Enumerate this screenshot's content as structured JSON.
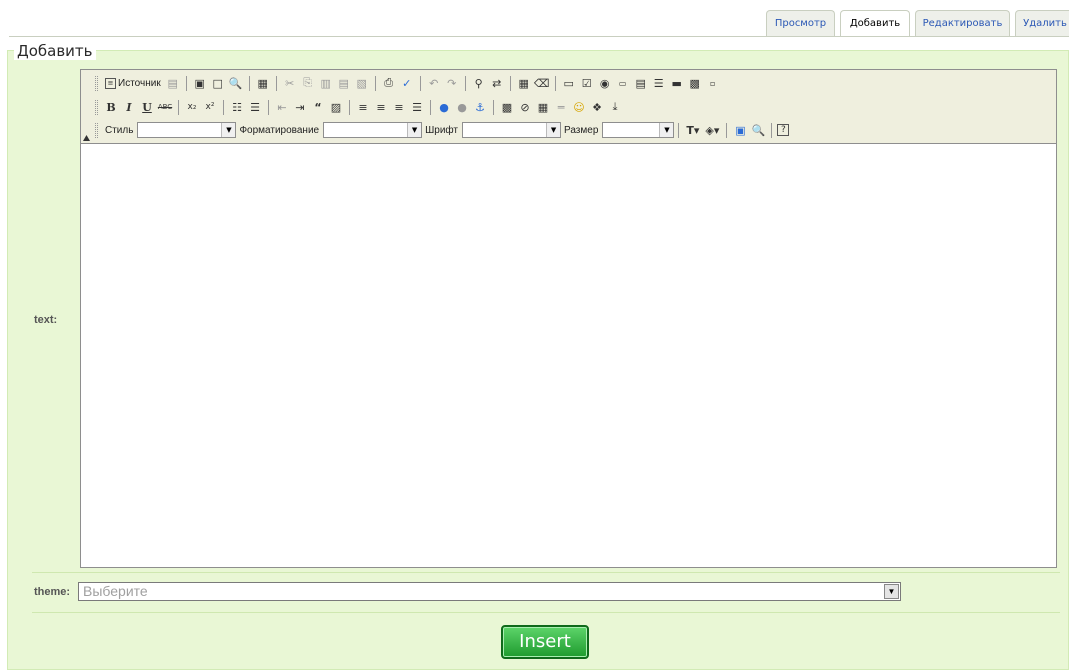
{
  "tabs": [
    {
      "label": "Просмотр",
      "active": false
    },
    {
      "label": "Добавить",
      "active": true
    },
    {
      "label": "Редактировать",
      "active": false
    },
    {
      "label": "Удалить",
      "active": false
    }
  ],
  "form": {
    "legend": "Добавить",
    "text_label": "text:",
    "theme_label": "theme:",
    "theme_value": "Выберите",
    "insert_label": "Insert"
  },
  "toolbar": {
    "source_label": "Источник",
    "style_label": "Стиль",
    "format_label": "Форматирование",
    "font_label": "Шрифт",
    "size_label": "Размер",
    "row1_icons": [
      "templates-icon",
      "save-icon",
      "new-page-icon",
      "preview-icon",
      "paste-template-icon",
      "cut-icon",
      "copy-icon",
      "paste-icon",
      "paste-text-icon",
      "paste-word-icon",
      "print-icon",
      "spellcheck-icon",
      "undo-icon",
      "redo-icon",
      "find-icon",
      "replace-icon",
      "select-all-icon",
      "remove-format-icon",
      "form-icon",
      "checkbox-icon",
      "radio-icon",
      "textfield-icon",
      "textarea-icon",
      "select-field-icon",
      "button-field-icon",
      "image-button-icon",
      "hidden-field-icon"
    ],
    "row2_icons": [
      "bold-icon",
      "italic-icon",
      "underline-icon",
      "strike-icon",
      "subscript-icon",
      "superscript-icon",
      "numbered-list-icon",
      "bulleted-list-icon",
      "outdent-icon",
      "indent-icon",
      "blockquote-icon",
      "div-icon",
      "align-left-icon",
      "align-center-icon",
      "align-right-icon",
      "justify-icon",
      "link-icon",
      "unlink-icon",
      "anchor-icon",
      "image-icon",
      "flash-icon",
      "table-icon",
      "horizontal-rule-icon",
      "smiley-icon",
      "special-char-icon",
      "page-break-icon"
    ],
    "row3_icons": [
      "text-color-icon",
      "background-color-icon",
      "maximize-icon",
      "show-blocks-icon",
      "about-icon"
    ]
  },
  "colors": {
    "panel_bg": "#e9f7d5",
    "toolbar_bg": "#efefde",
    "tab_link": "#2b58b5",
    "insert_green": "#1e9a2e"
  }
}
